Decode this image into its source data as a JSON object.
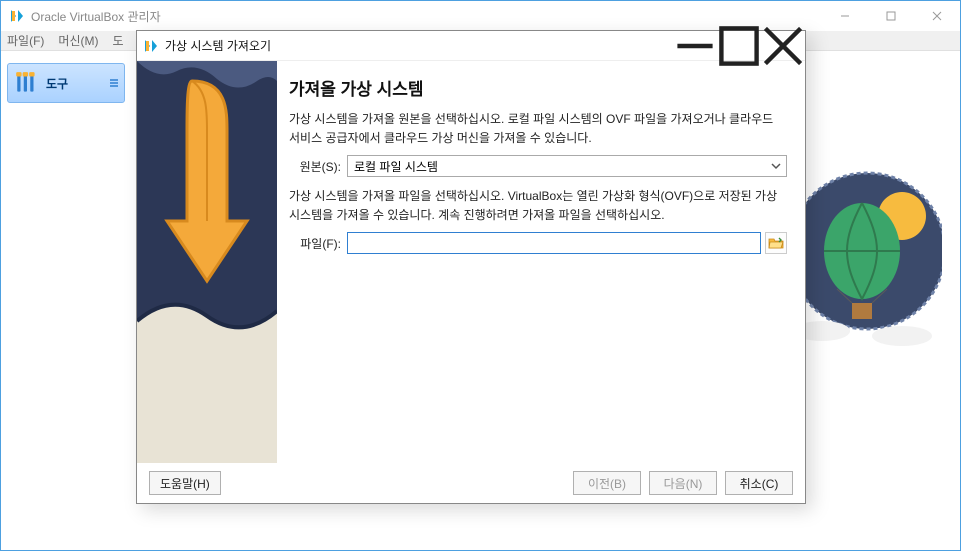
{
  "main_window": {
    "title": "Oracle VirtualBox 관리자",
    "menu": {
      "file": "파일(F)",
      "machine": "머신(M)",
      "help_trunc": "도"
    },
    "tools_button": "도구"
  },
  "dialog": {
    "title": "가상 시스템 가져오기",
    "heading": "가져올 가상 시스템",
    "para1": "가상 시스템을 가져올 원본을 선택하십시오. 로컬 파일 시스템의 OVF 파일을 가져오거나 클라우드 서비스 공급자에서 클라우드 가상 머신을 가져올 수 있습니다.",
    "source_label": "원본(S):",
    "source_value": "로컬 파일 시스템",
    "para2": "가상 시스템을 가져올 파일을 선택하십시오. VirtualBox는 열린 가상화 형식(OVF)으로 저장된 가상 시스템을 가져올 수 있습니다. 계속 진행하려면 가져올 파일을 선택하십시오.",
    "file_label": "파일(F):",
    "file_value": "",
    "buttons": {
      "help": "도움말(H)",
      "back": "이전(B)",
      "next": "다음(N)",
      "cancel": "취소(C)"
    }
  }
}
